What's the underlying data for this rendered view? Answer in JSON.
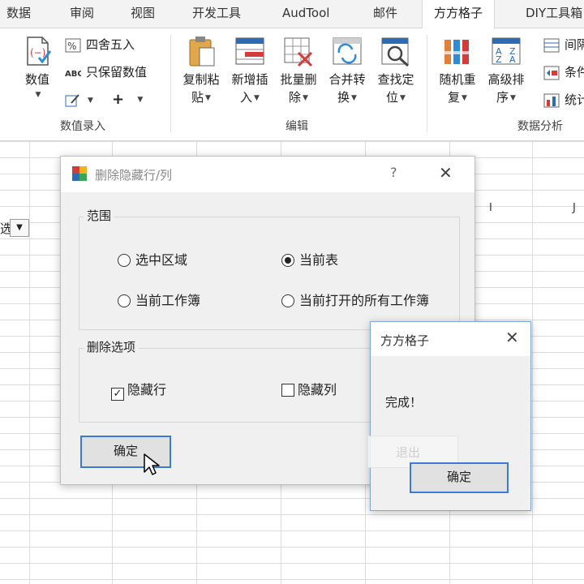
{
  "tabs": [
    {
      "label": "数据",
      "active": false
    },
    {
      "label": "审阅",
      "active": false
    },
    {
      "label": "视图",
      "active": false
    },
    {
      "label": "开发工具",
      "active": false
    },
    {
      "label": "AudTool",
      "active": false
    },
    {
      "label": "邮件",
      "active": false
    },
    {
      "label": "方方格子",
      "active": true
    },
    {
      "label": "DIY工具箱",
      "active": false
    }
  ],
  "ribbon": {
    "group_numeric": {
      "label": "数值录入",
      "numeric_button": "数值",
      "round_label": "四舍五入",
      "keep_value_label": "只保留数值",
      "plus_symbol": "+"
    },
    "group_edit": {
      "label": "编辑",
      "buttons": [
        {
          "line1": "复制粘",
          "line2": "贴"
        },
        {
          "line1": "新增插",
          "line2": "入"
        },
        {
          "line1": "批量删",
          "line2": "除"
        },
        {
          "line1": "合并转",
          "line2": "换"
        },
        {
          "line1": "查找定",
          "line2": "位"
        }
      ]
    },
    "group_analysis": {
      "label": "数据分析",
      "buttons": [
        {
          "line1": "随机重",
          "line2": "复"
        },
        {
          "line1": "高级排",
          "line2": "序"
        }
      ],
      "small_items": [
        "间隔",
        "条件",
        "统计"
      ]
    }
  },
  "sheet": {
    "column_headers": [
      "I",
      "J"
    ],
    "cell_stub": "选"
  },
  "dialog_delete": {
    "title": "删除隐藏行/列",
    "help": "?",
    "close": "✕",
    "scope_legend": "范围",
    "scope_options": [
      {
        "label": "选中区域",
        "selected": false
      },
      {
        "label": "当前表",
        "selected": true
      },
      {
        "label": "当前工作簿",
        "selected": false
      },
      {
        "label": "当前打开的所有工作簿",
        "selected": false
      }
    ],
    "delete_legend": "删除选项",
    "delete_options": [
      {
        "label": "隐藏行",
        "checked": true
      },
      {
        "label": "隐藏列",
        "checked": false
      }
    ],
    "ok_button": "确定"
  },
  "dialog_done": {
    "title": "方方格子",
    "close": "✕",
    "message": "完成！",
    "exit_ghost": "退出",
    "ok_button": "确定"
  },
  "colors": {
    "accent_blue": "#3a7bd5",
    "dialog_bg": "#f0f0f0",
    "grid_line": "#dcdcdc"
  }
}
